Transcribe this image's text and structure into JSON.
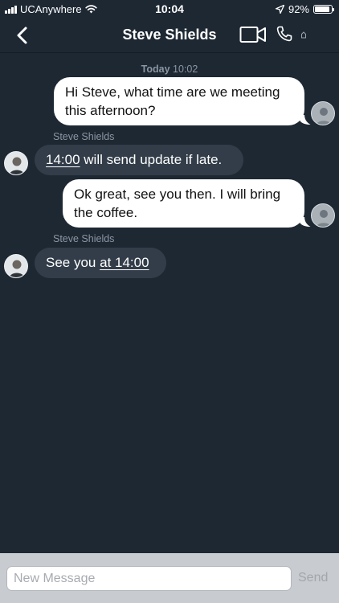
{
  "status_bar": {
    "carrier": "UCAnywhere",
    "time": "10:04",
    "battery_text": "92%",
    "battery_level": 0.92,
    "icons": [
      "signal-icon",
      "wifi-icon",
      "location-arrow-icon",
      "battery-icon"
    ]
  },
  "nav": {
    "title": "Steve Shields",
    "icons": [
      "back-chevron-icon",
      "video-call-icon",
      "phone-call-icon",
      "more-icon"
    ]
  },
  "conversation": {
    "date_label_day": "Today",
    "date_label_time": "10:02",
    "messages": [
      {
        "direction": "outgoing",
        "text": "Hi Steve, what time are we meeting this afternoon?"
      },
      {
        "direction": "incoming",
        "sender": "Steve Shields",
        "link_text": "14:00",
        "text": " will send update if late."
      },
      {
        "direction": "outgoing",
        "text": "Ok great, see you then. I will bring the coffee."
      },
      {
        "direction": "incoming",
        "sender": "Steve Shields",
        "text": "See you ",
        "link_text": "at 14:00"
      }
    ]
  },
  "composer": {
    "placeholder": "New Message",
    "send_label": "Send"
  },
  "colors": {
    "background": "#1e2833",
    "incoming_bubble": "#323d49",
    "outgoing_bubble": "#ffffff",
    "composer_bg": "#c8cbcf"
  }
}
